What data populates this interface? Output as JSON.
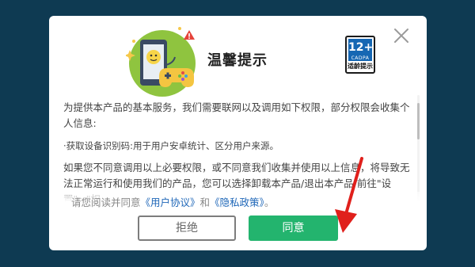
{
  "dialog": {
    "title": "温馨提示",
    "age_rating": {
      "age": "12+",
      "org": "CADPA",
      "label": "适龄提示"
    },
    "close_icon": "close-icon",
    "body": {
      "paragraph1": "为提供本产品的基本服务，我们需要联网以及调用如下权限，部分权限会收集个人信息:",
      "paragraph2": "·获取设备识别码:用于用户安卓统计、区分用户来源。",
      "paragraph3": "如果您不同意调用以上必要权限，或不同意我们收集并使用以上信息，将导致无法正常运行和使用我们的产品，您可以选择卸载本产品/退出本产品/前往\"设置\">\"权"
    },
    "agreement": {
      "prefix": "请您阅读并同意",
      "user_agreement": "《用户协议》",
      "conjunction": "和",
      "privacy_policy": "《隐私政策》",
      "suffix": "。"
    },
    "buttons": {
      "refuse": "拒绝",
      "agree": "同意"
    }
  },
  "colors": {
    "background": "#0e3a52",
    "agree_button": "#23b46e",
    "link": "#1f67b8",
    "arrow": "#e0201c"
  }
}
